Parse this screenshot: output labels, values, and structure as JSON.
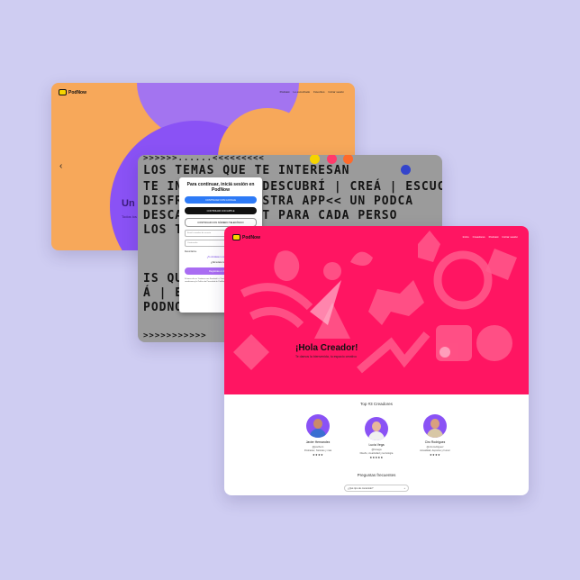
{
  "colors": {
    "background": "#cfcdf2",
    "orange": "#f7a85a",
    "purple": "#8a52f5",
    "pink": "#ff1562",
    "yellow": "#f5d400"
  },
  "brand": "PodNow",
  "card1": {
    "nav": [
      "Podcast",
      "Lo escuchado",
      "Favoritos",
      "Iniciar sesión"
    ],
    "title": "Un",
    "subtitle": "Todos los"
  },
  "card2": {
    "pattern_rows": [
      ">>>>>>......<<<<<<<<<",
      "LOS TEMAS QUE TE INTERESAN",
      "TE INVITAMOS A DESCUBRÍ | CREÁ | ESCUCHÁ |",
      "DISFRUTÁ DE NUESTRA APP<< UN PODCA",
      "DESCARGÁ PODCAST PARA CADA PERSO",
      "LOS TEMAS QUE",
      "...",
      "IS QUE",
      "Á | ESCUCHÁ",
      "PODNOOOOOO",
      ">>>>>>>>>>>"
    ],
    "modal": {
      "title": "Para continuar, iniciá sesión en PodNow",
      "google": "CONTINUAR CON GOOGLE",
      "apple": "CONTINUAR CON APPLE",
      "phone": "CONTINUAR CON NÚMERO TELEFÓNICO",
      "email_placeholder": "Email o nombre de usuario",
      "password_placeholder": "Contraseña",
      "remember": "Recordarme",
      "login": "Iniciar Sesión",
      "forgot": "¿Te olvidaste tu contraseña?",
      "no_account": "¿No tenés cuenta?",
      "register": "Registrate en PodNow",
      "legal": "Si haces clic en 'Continuar con Facebook' o 'Continuar con Apple', aceptas los Términos y condiciones y la Política de Privacidad de PodNow."
    }
  },
  "card3": {
    "nav": [
      "Inicio",
      "Creadores",
      "Podcast",
      "Iniciar sesión"
    ],
    "hero_title": "¡Hola Creador!",
    "hero_subtitle": "Te damos la bienvenida, tu espacio creativo",
    "top_title": "Top #3 Creadores",
    "creators": [
      {
        "name": "Javier Hernandez",
        "handle": "@javihern",
        "desc": "Podcaster, historias y más",
        "stars": "★★★★"
      },
      {
        "name": "Lucía Vega",
        "handle": "@luvega",
        "desc": "Diseño, creatividad y tecnología",
        "stars": "★★★★★"
      },
      {
        "name": "Ciro Rodriguez",
        "handle": "@cirorodriguez",
        "desc": "Actualidad, deportes y humor",
        "stars": "★★★★"
      }
    ],
    "faq_title": "Preguntas frecuentes",
    "faq_item": "¿Qué tipo de contenido?"
  }
}
